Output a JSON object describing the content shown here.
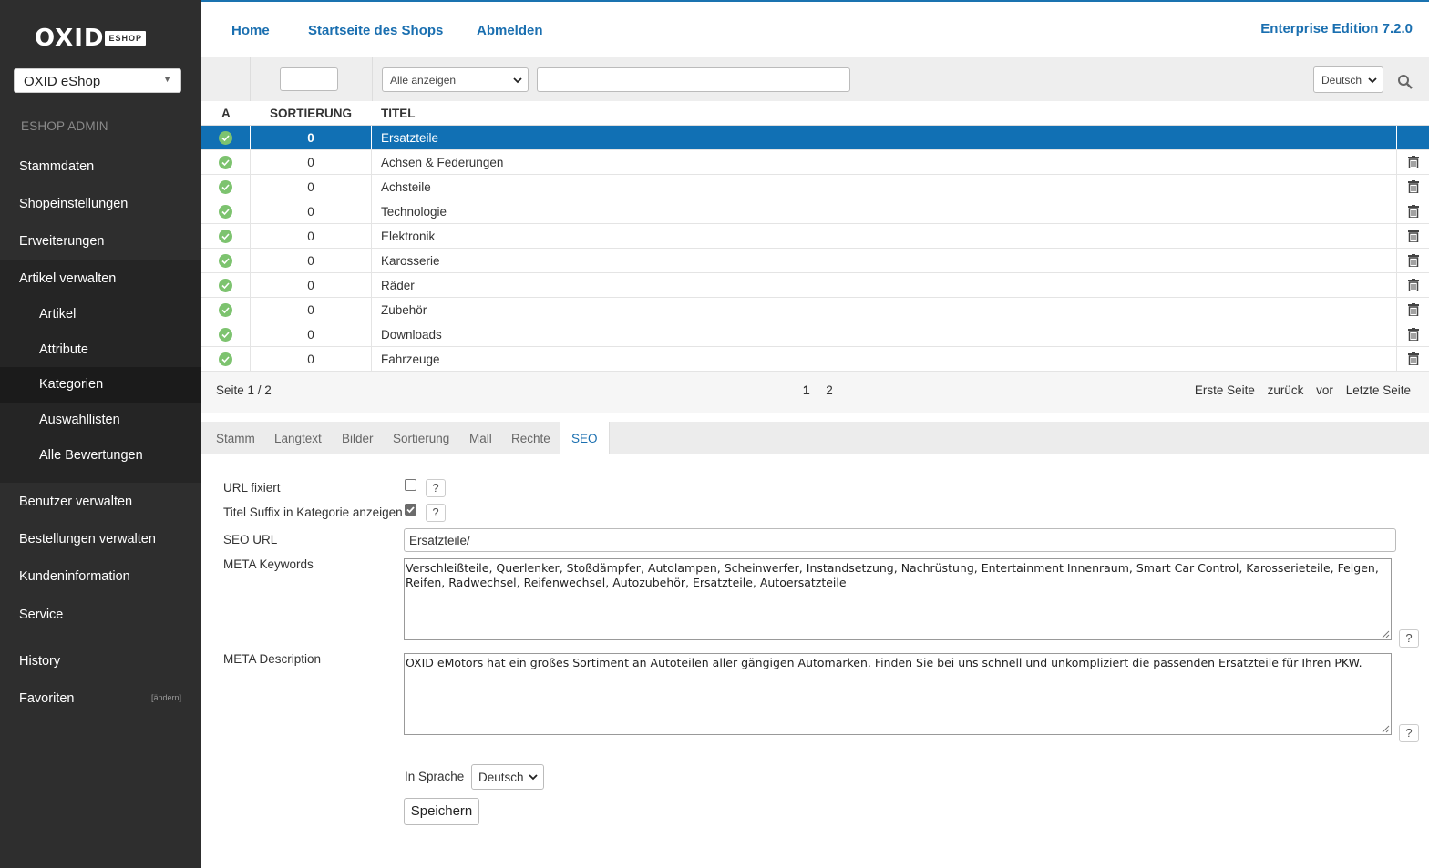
{
  "sidebar": {
    "logo_word": "OXID",
    "logo_badge": "ESHOP",
    "shop_select": "OXID eShop",
    "admin_title": "ESHOP ADMIN",
    "items": {
      "stammdaten": "Stammdaten",
      "shopeinstellungen": "Shopeinstellungen",
      "erweiterungen": "Erweiterungen",
      "artikel_verwalten": "Artikel verwalten",
      "artikel": "Artikel",
      "attribute": "Attribute",
      "kategorien": "Kategorien",
      "auswahllisten": "Auswahllisten",
      "alle_bewertungen": "Alle Bewertungen",
      "benutzer_verwalten": "Benutzer verwalten",
      "bestellungen_verwalten": "Bestellungen verwalten",
      "kundeninformation": "Kundeninformation",
      "service": "Service",
      "history": "History",
      "favoriten": "Favoriten",
      "favoriten_change": "[ändern]"
    }
  },
  "topbar": {
    "home": "Home",
    "startseite": "Startseite des Shops",
    "abmelden": "Abmelden",
    "edition": "Enterprise Edition 7.2.0"
  },
  "filter": {
    "type_select": "Alle anzeigen",
    "lang_select": "Deutsch"
  },
  "table": {
    "headers": {
      "active": "A",
      "sort": "SORTIERUNG",
      "title": "TITEL"
    },
    "rows": [
      {
        "sort": "0",
        "title": "Ersatzteile"
      },
      {
        "sort": "0",
        "title": "Achsen & Federungen"
      },
      {
        "sort": "0",
        "title": "Achsteile"
      },
      {
        "sort": "0",
        "title": "Technologie"
      },
      {
        "sort": "0",
        "title": "Elektronik"
      },
      {
        "sort": "0",
        "title": "Karosserie"
      },
      {
        "sort": "0",
        "title": "Räder"
      },
      {
        "sort": "0",
        "title": "Zubehör"
      },
      {
        "sort": "0",
        "title": "Downloads"
      },
      {
        "sort": "0",
        "title": "Fahrzeuge"
      }
    ]
  },
  "pager": {
    "info": "Seite 1 / 2",
    "page1": "1",
    "page2": "2",
    "first": "Erste Seite",
    "back": "zurück",
    "next": "vor",
    "last": "Letzte Seite"
  },
  "tabs": {
    "stamm": "Stamm",
    "langtext": "Langtext",
    "bilder": "Bilder",
    "sortierung": "Sortierung",
    "mall": "Mall",
    "rechte": "Rechte",
    "seo": "SEO"
  },
  "form": {
    "url_fixiert_label": "URL fixiert",
    "title_suffix_label": "Titel Suffix in Kategorie anzeigen",
    "seo_url_label": "SEO URL",
    "seo_url_value": "Ersatzteile/",
    "meta_keywords_label": "META Keywords",
    "meta_keywords_value": "Verschleißteile, Querlenker, Stoßdämpfer, Autolampen, Scheinwerfer, Instandsetzung, Nachrüstung, Entertainment Innenraum, Smart Car Control, Karosserieteile, Felgen, Reifen, Radwechsel, Reifenwechsel, Autozubehör, Ersatzteile, Autoersatzteile",
    "meta_description_label": "META Description",
    "meta_description_value": "OXID eMotors hat ein großes Sortiment an Autoteilen aller gängigen Automarken. Finden Sie bei uns schnell und unkompliziert die passenden Ersatzteile für Ihren PKW.",
    "help": "?",
    "in_sprache_label": "In Sprache",
    "in_sprache_value": "Deutsch",
    "save": "Speichern"
  },
  "colors": {
    "sidebar_bg": "#2e2e2e",
    "accent_blue": "#1a6fb0",
    "selected_row": "#1170b4",
    "active_dot": "#7dc36f"
  }
}
